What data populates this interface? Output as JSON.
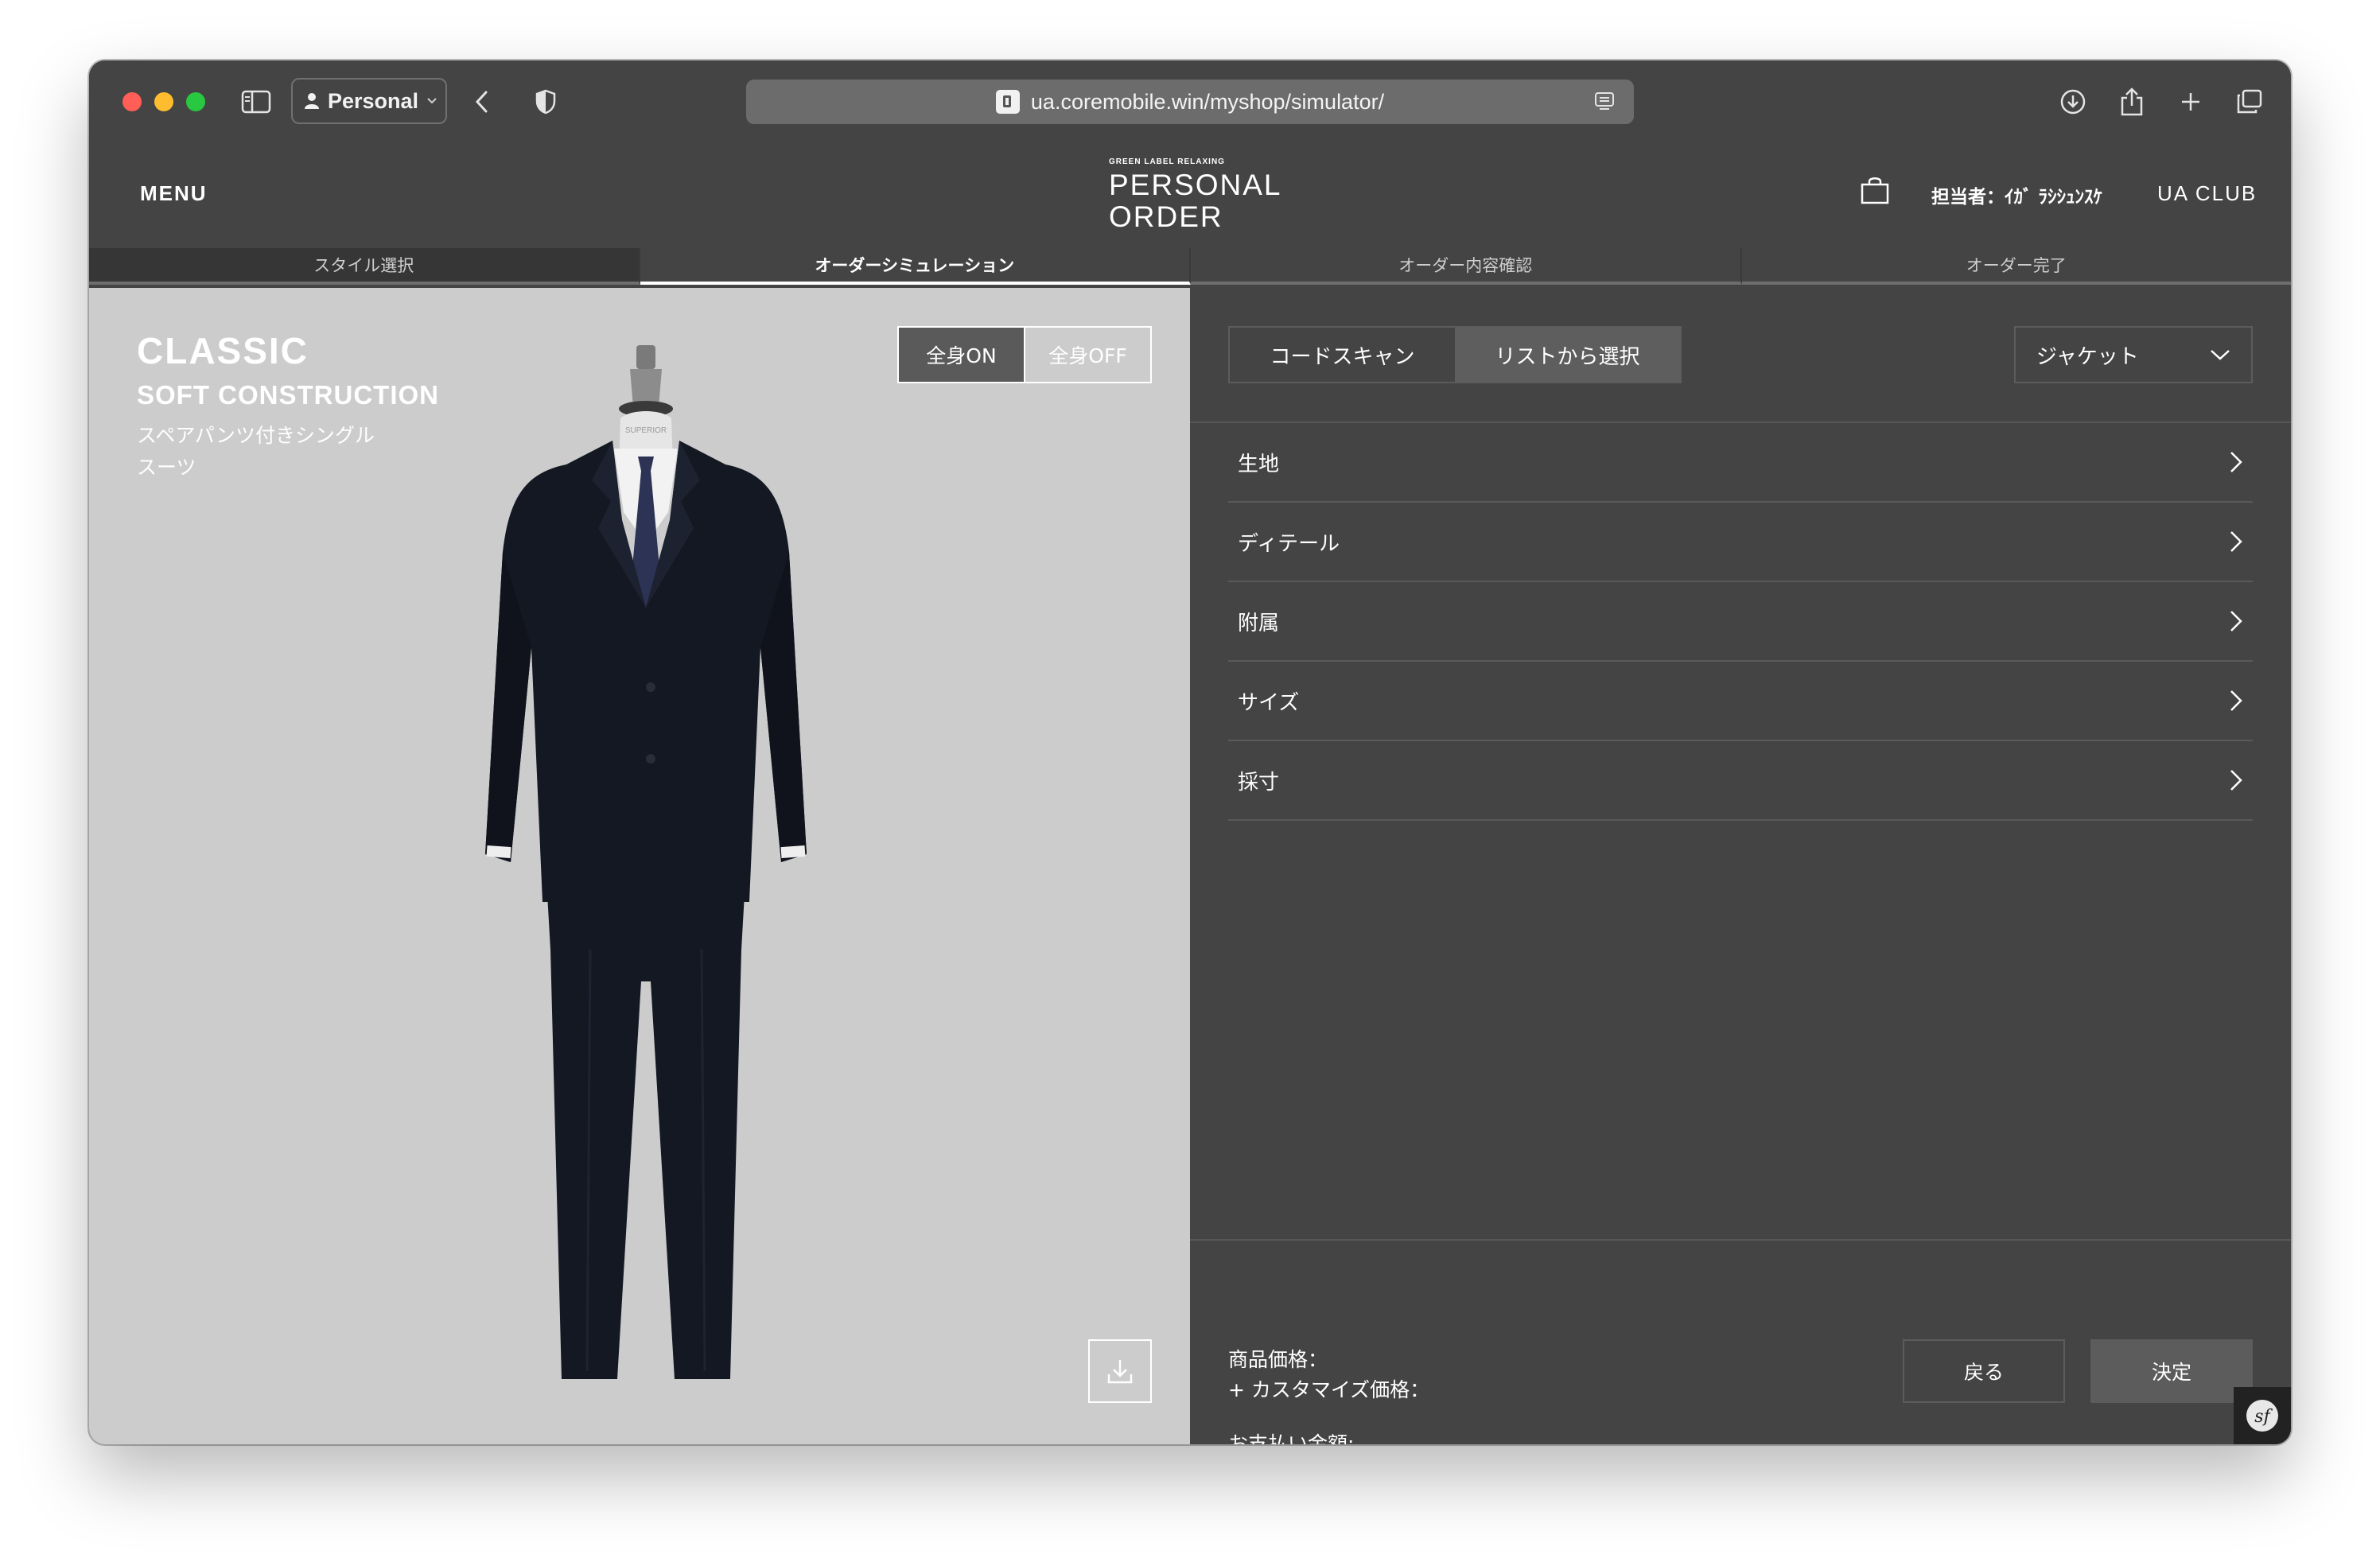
{
  "browser": {
    "profile_label": "Personal",
    "url": "ua.coremobile.win/myshop/simulator/"
  },
  "header": {
    "menu_label": "MENU",
    "logo_small": "GREEN LABEL RELAXING",
    "logo_line1": "PERSONAL",
    "logo_line2": "ORDER",
    "staff_label": "担当者：ｲｶﾞ ﾗｼｼｭﾝｽｹ",
    "club_label": "UA CLUB"
  },
  "steps": [
    {
      "label": "スタイル選択"
    },
    {
      "label": "オーダーシミュレーション"
    },
    {
      "label": "オーダー内容確認"
    },
    {
      "label": "オーダー完了"
    }
  ],
  "style": {
    "title": "CLASSIC",
    "subtitle": "SOFT CONSTRUCTION",
    "description": "スペアパンツ付きシングルスーツ"
  },
  "view_toggle": {
    "on_label": "全身ON",
    "off_label": "全身OFF"
  },
  "mode_tabs": {
    "scan_label": "コードスキャン",
    "list_label": "リストから選択"
  },
  "part_select": {
    "selected": "ジャケット"
  },
  "options": [
    {
      "label": "生地"
    },
    {
      "label": "ディテール"
    },
    {
      "label": "附属"
    },
    {
      "label": "サイズ"
    },
    {
      "label": "採寸"
    }
  ],
  "pricing": {
    "product_price_label": "商品価格：",
    "custom_price_label": "+ カスタマイズ価格：",
    "total_label": "お支払い金額:"
  },
  "actions": {
    "back_label": "戻る",
    "confirm_label": "決定"
  },
  "colors": {
    "chrome": "#444444",
    "left_panel": "#cccccc",
    "accent_button": "#5c5c5c",
    "suit": "#141822",
    "tie": "#2c3354"
  }
}
